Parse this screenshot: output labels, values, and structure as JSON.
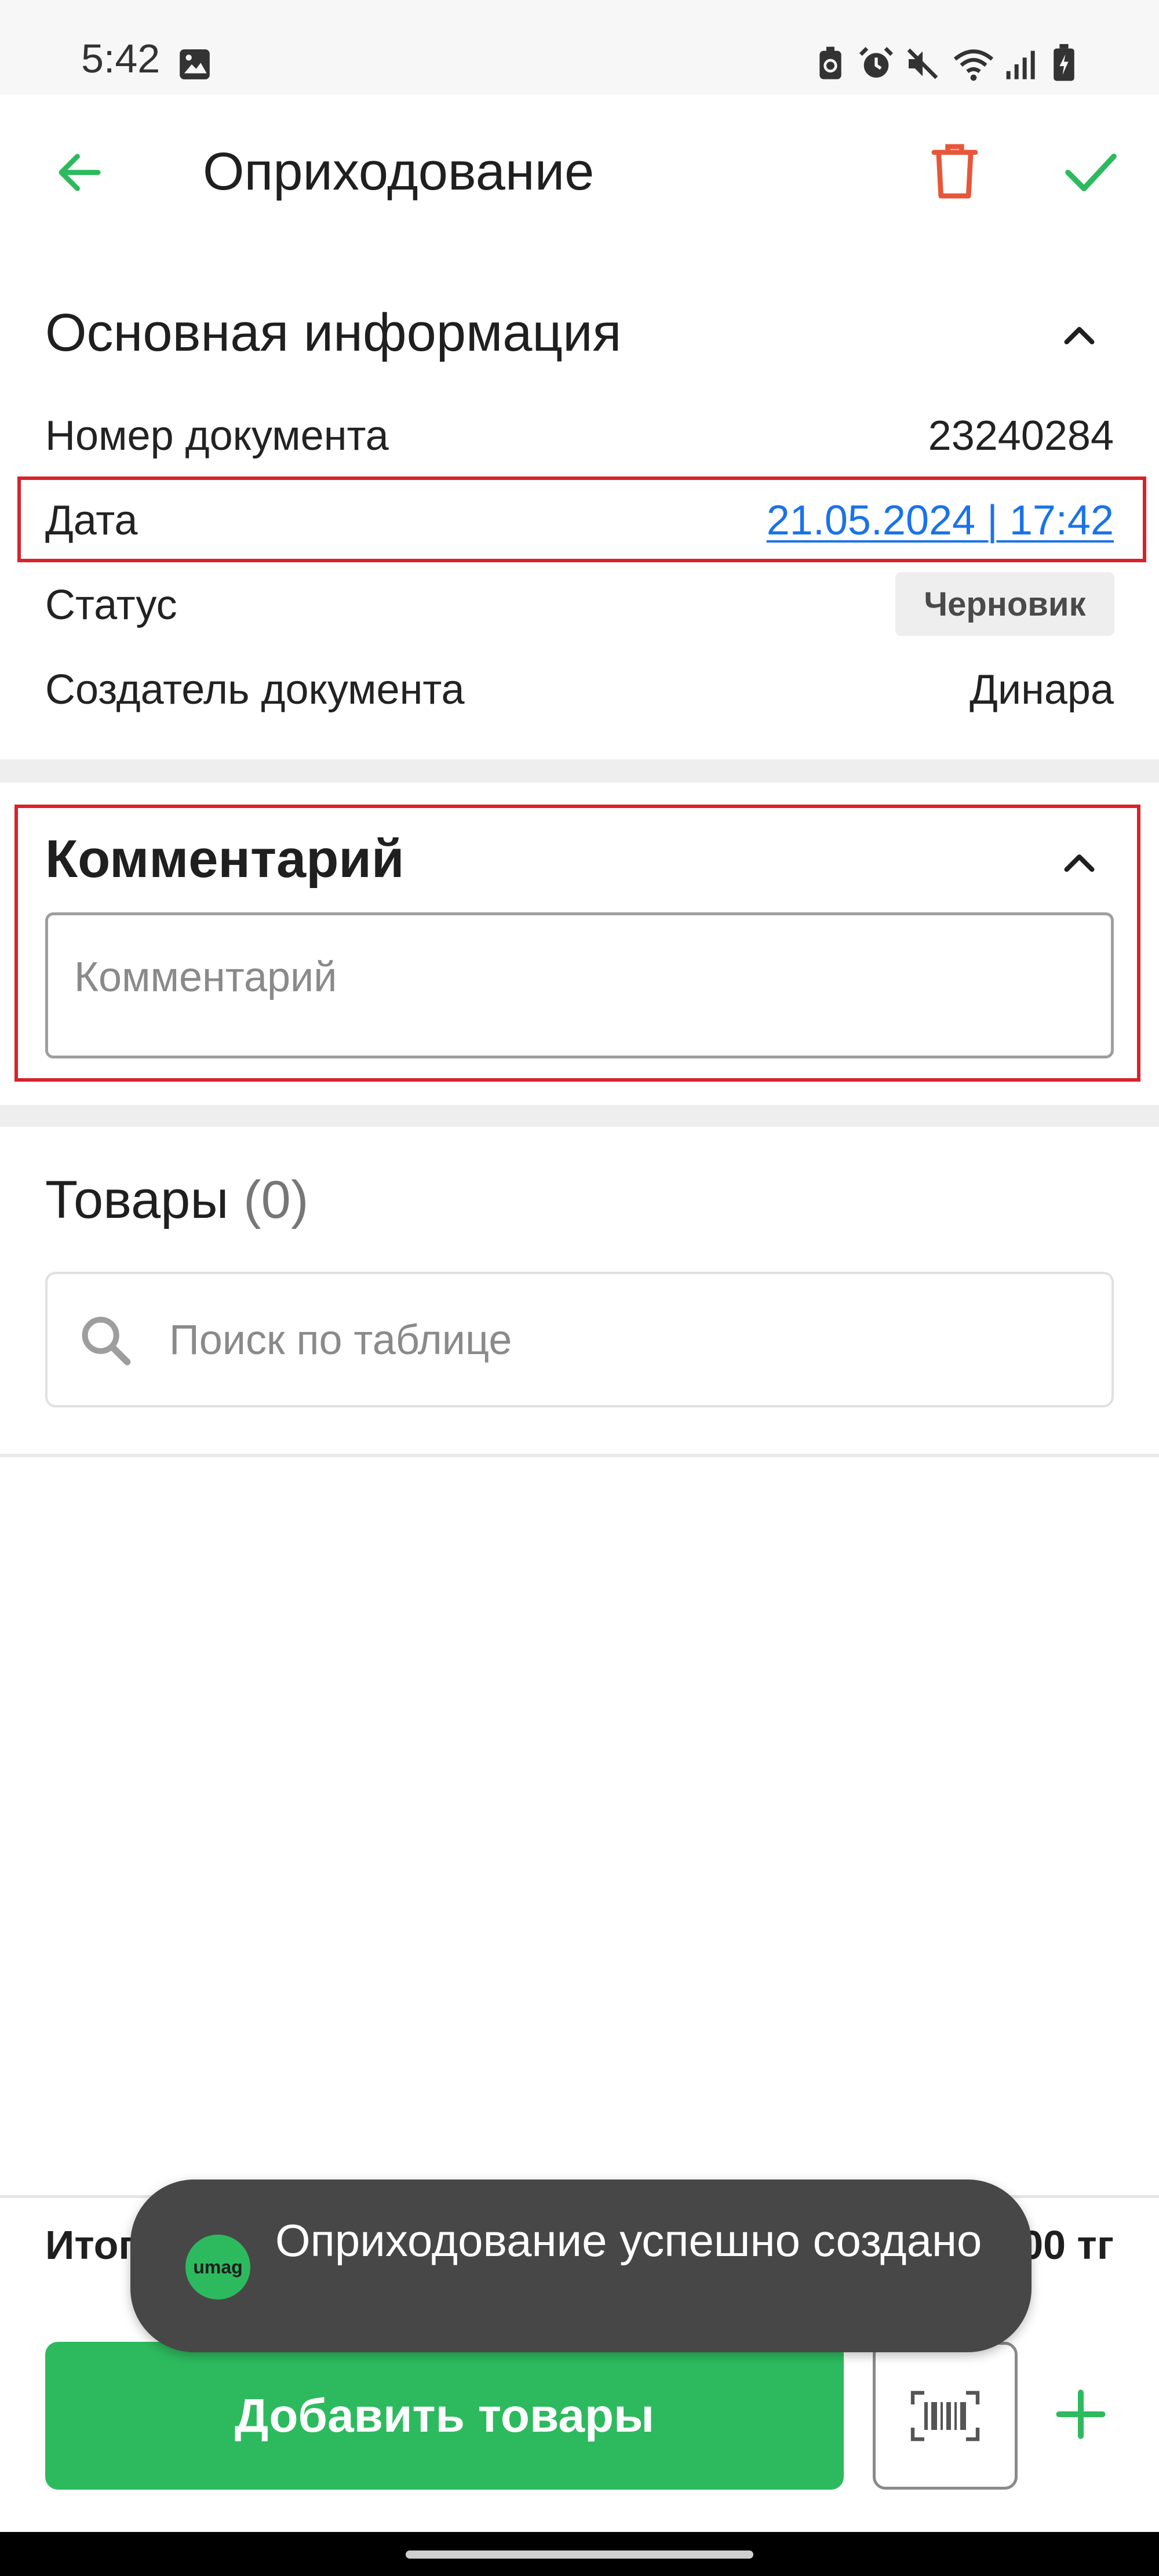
{
  "status_bar": {
    "time": "5:42",
    "icons": [
      "gallery-icon",
      "battery-saver-icon",
      "alarm-icon",
      "mute-icon",
      "wifi-icon",
      "signal-icon",
      "battery-charging-icon"
    ]
  },
  "app_bar": {
    "title": "Оприходование",
    "back_icon": "arrow-left-icon",
    "delete_icon": "trash-icon",
    "confirm_icon": "check-icon"
  },
  "basic_info": {
    "heading": "Основная информация",
    "rows": [
      {
        "label": "Номер документа",
        "value": "23240284"
      },
      {
        "label": "Дата",
        "value": "21.05.2024 | 17:42"
      },
      {
        "label": "Статус",
        "value": "Черновик"
      },
      {
        "label": "Создатель документа",
        "value": "Динара"
      }
    ]
  },
  "comment": {
    "heading": "Комментарий",
    "placeholder": "Комментарий",
    "value": ""
  },
  "products": {
    "heading": "Товары",
    "count": "(0)",
    "search_placeholder": "Поиск по таблице"
  },
  "footer": {
    "total_label": "Итого",
    "total_value": "0.00 тг",
    "add_button": "Добавить товары"
  },
  "toast": {
    "app_badge": "umag",
    "message": "Оприходование успешно создано"
  },
  "colors": {
    "accent": "#2dba5e",
    "danger": "#e8563a",
    "link": "#1a73e8",
    "highlight_border": "#d9222a"
  }
}
